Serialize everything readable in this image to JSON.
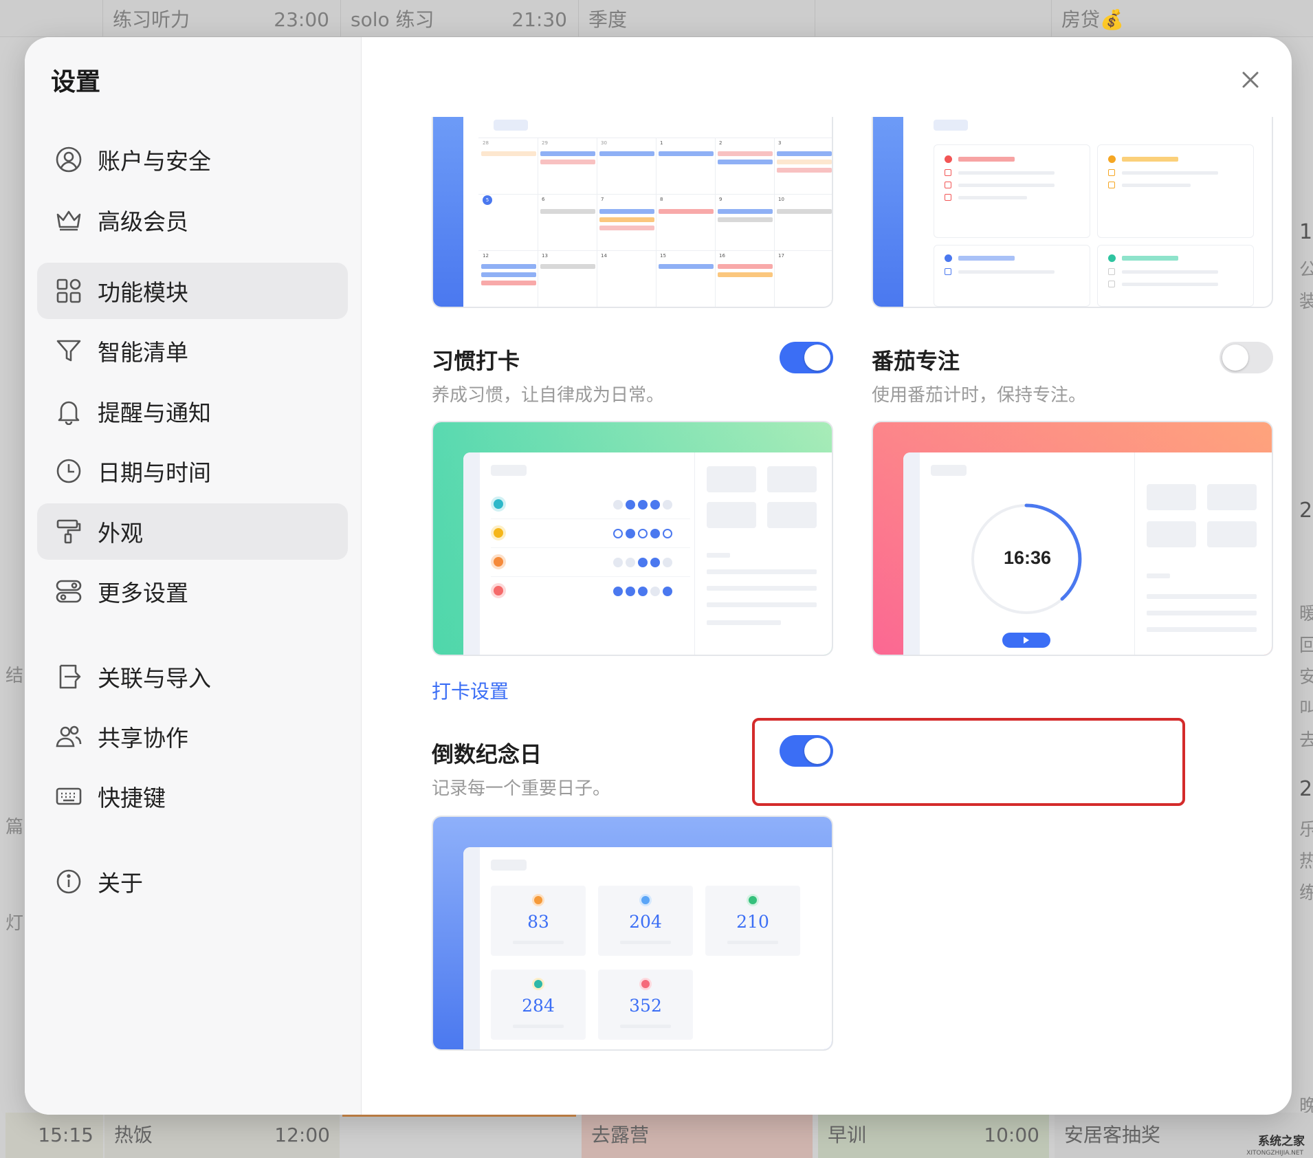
{
  "background": {
    "top_cells": [
      {
        "title": "练习听力",
        "time": "23:00"
      },
      {
        "title": "solo 练习",
        "time": "21:30"
      },
      {
        "title": "季度",
        "time": ""
      },
      {
        "title": "房贷💰",
        "time": ""
      }
    ],
    "bottom_cells": [
      {
        "title": "",
        "time": "15:15"
      },
      {
        "title": "热饭",
        "time": "12:00"
      },
      {
        "title": "去露营",
        "time": ""
      },
      {
        "title": "早训",
        "time": "10:00"
      },
      {
        "title": "安居客抽奖",
        "time": ""
      }
    ],
    "left_fragments": [
      "结",
      "篇",
      "灯"
    ],
    "right_fragments": [
      "1",
      "公",
      "装",
      "2",
      "暖",
      "回",
      "安",
      "叫",
      "去",
      "2",
      "乐",
      "热",
      "练",
      "晚"
    ],
    "watermark": "系统之家",
    "watermark_sub": "XITONGZHIJIA.NET"
  },
  "settings": {
    "title": "设置",
    "nav": [
      {
        "label": "账户与安全",
        "icon": "user-circle-icon"
      },
      {
        "label": "高级会员",
        "icon": "crown-icon"
      },
      {
        "label": "功能模块",
        "icon": "modules-icon"
      },
      {
        "label": "智能清单",
        "icon": "filter-icon"
      },
      {
        "label": "提醒与通知",
        "icon": "bell-icon"
      },
      {
        "label": "日期与时间",
        "icon": "clock-icon"
      },
      {
        "label": "外观",
        "icon": "paint-roller-icon"
      },
      {
        "label": "更多设置",
        "icon": "toggles-icon"
      },
      {
        "label": "关联与导入",
        "icon": "import-icon"
      },
      {
        "label": "共享协作",
        "icon": "users-icon"
      },
      {
        "label": "快捷键",
        "icon": "keyboard-icon"
      },
      {
        "label": "关于",
        "icon": "info-icon"
      }
    ],
    "active_nav": "功能模块"
  },
  "features": {
    "habit": {
      "name": "习惯打卡",
      "desc": "养成习惯，让自律成为日常。",
      "enabled": true,
      "link": "打卡设置"
    },
    "pomodoro": {
      "name": "番茄专注",
      "desc": "使用番茄计时，保持专注。",
      "enabled": false,
      "timer": "16:36"
    },
    "countdown": {
      "name": "倒数纪念日",
      "desc": "记录每一个重要日子。",
      "enabled": true,
      "numbers": [
        "83",
        "204",
        "210",
        "284",
        "352"
      ]
    },
    "calendar_preview": {
      "day_numbers": [
        "28",
        "29",
        "30",
        "1",
        "2",
        "3",
        "5",
        "6",
        "7",
        "8",
        "9",
        "10",
        "12",
        "13",
        "14",
        "15",
        "16",
        "17"
      ]
    }
  },
  "colors": {
    "accent": "#3b6ef5",
    "highlight_border": "#d42b2b"
  }
}
